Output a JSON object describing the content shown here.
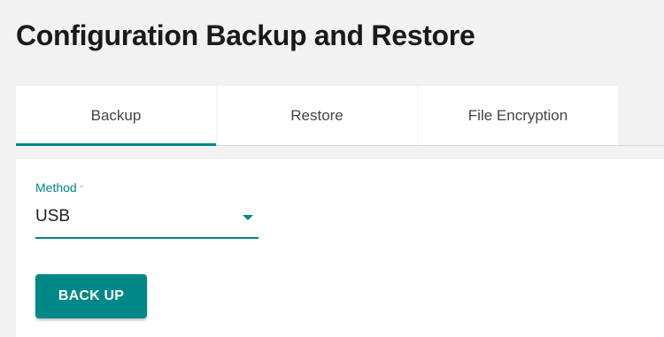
{
  "page": {
    "title": "Configuration Backup and Restore"
  },
  "tabs": [
    {
      "label": "Backup",
      "active": true
    },
    {
      "label": "Restore",
      "active": false
    },
    {
      "label": "File Encryption",
      "active": false
    }
  ],
  "form": {
    "method_label": "Method",
    "required_mark": "*",
    "method_value": "USB",
    "caret_icon": "chevron-down-icon"
  },
  "actions": {
    "backup_label": "BACK UP"
  },
  "colors": {
    "accent": "#008787",
    "background": "#f2f2f2",
    "surface": "#ffffff"
  }
}
